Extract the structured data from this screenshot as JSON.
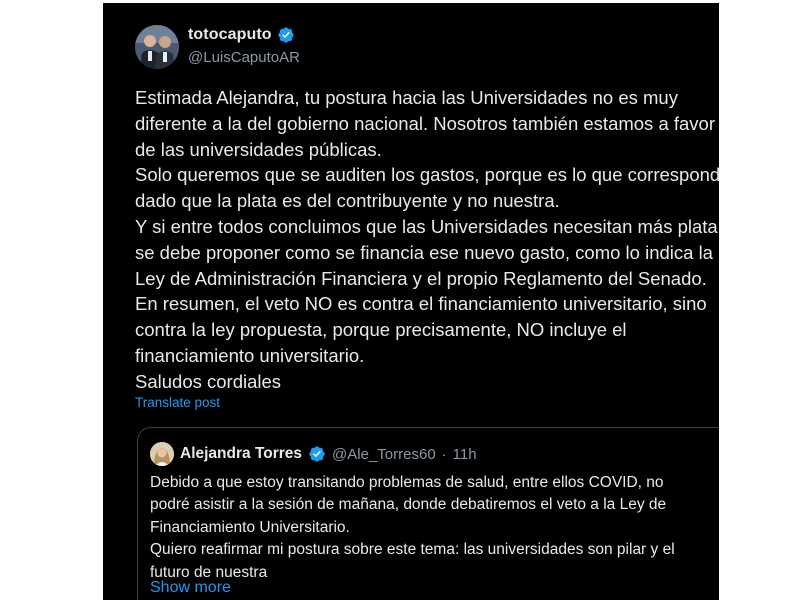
{
  "tweet": {
    "author_name": "totocaputo",
    "author_handle": "@LuisCaputoAR",
    "verified": true,
    "body_lines": [
      "Estimada Alejandra, tu postura hacia las Universidades no es muy",
      "diferente a la del gobierno nacional. Nosotros también estamos a favor",
      "de las universidades públicas.",
      "Solo queremos que se auditen los gastos, porque es lo que corresponde,",
      "dado que la plata es del contribuyente y no nuestra.",
      "Y si entre todos concluimos que las Universidades necesitan más plata,",
      "se debe proponer como se financia ese nuevo gasto, como lo indica la",
      "Ley de Administración Financiera y el propio Reglamento del Senado.",
      "En resumen, el veto NO es contra el financiamiento universitario, sino",
      "contra la ley propuesta, porque precisamente, NO incluye el",
      "financiamiento universitario.",
      "Saludos cordiales"
    ],
    "translate_label": "Translate post"
  },
  "quote": {
    "author_name": "Alejandra Torres",
    "author_handle": "@Ale_Torres60",
    "separator": "·",
    "time": "11h",
    "verified": true,
    "body_lines": [
      "Debido a que estoy transitando problemas de salud, entre ellos COVID, no",
      "podré asistir a la sesión de mañana, donde debatiremos el veto a la Ley de",
      "Financiamiento Universitario.",
      "Quiero reafirmar mi postura sobre este tema: las universidades son pilar y el",
      "futuro de nuestra"
    ],
    "show_more_label": "Show more"
  },
  "colors": {
    "background": "#000000",
    "text": "#e7e9ea",
    "secondary_text": "#8b98a5",
    "link": "#1d9bf0",
    "verified_badge": "#1d9bf0"
  },
  "icons": {
    "verified": "verified-badge-icon",
    "avatar_main": "avatar",
    "avatar_quote": "quote-avatar"
  }
}
